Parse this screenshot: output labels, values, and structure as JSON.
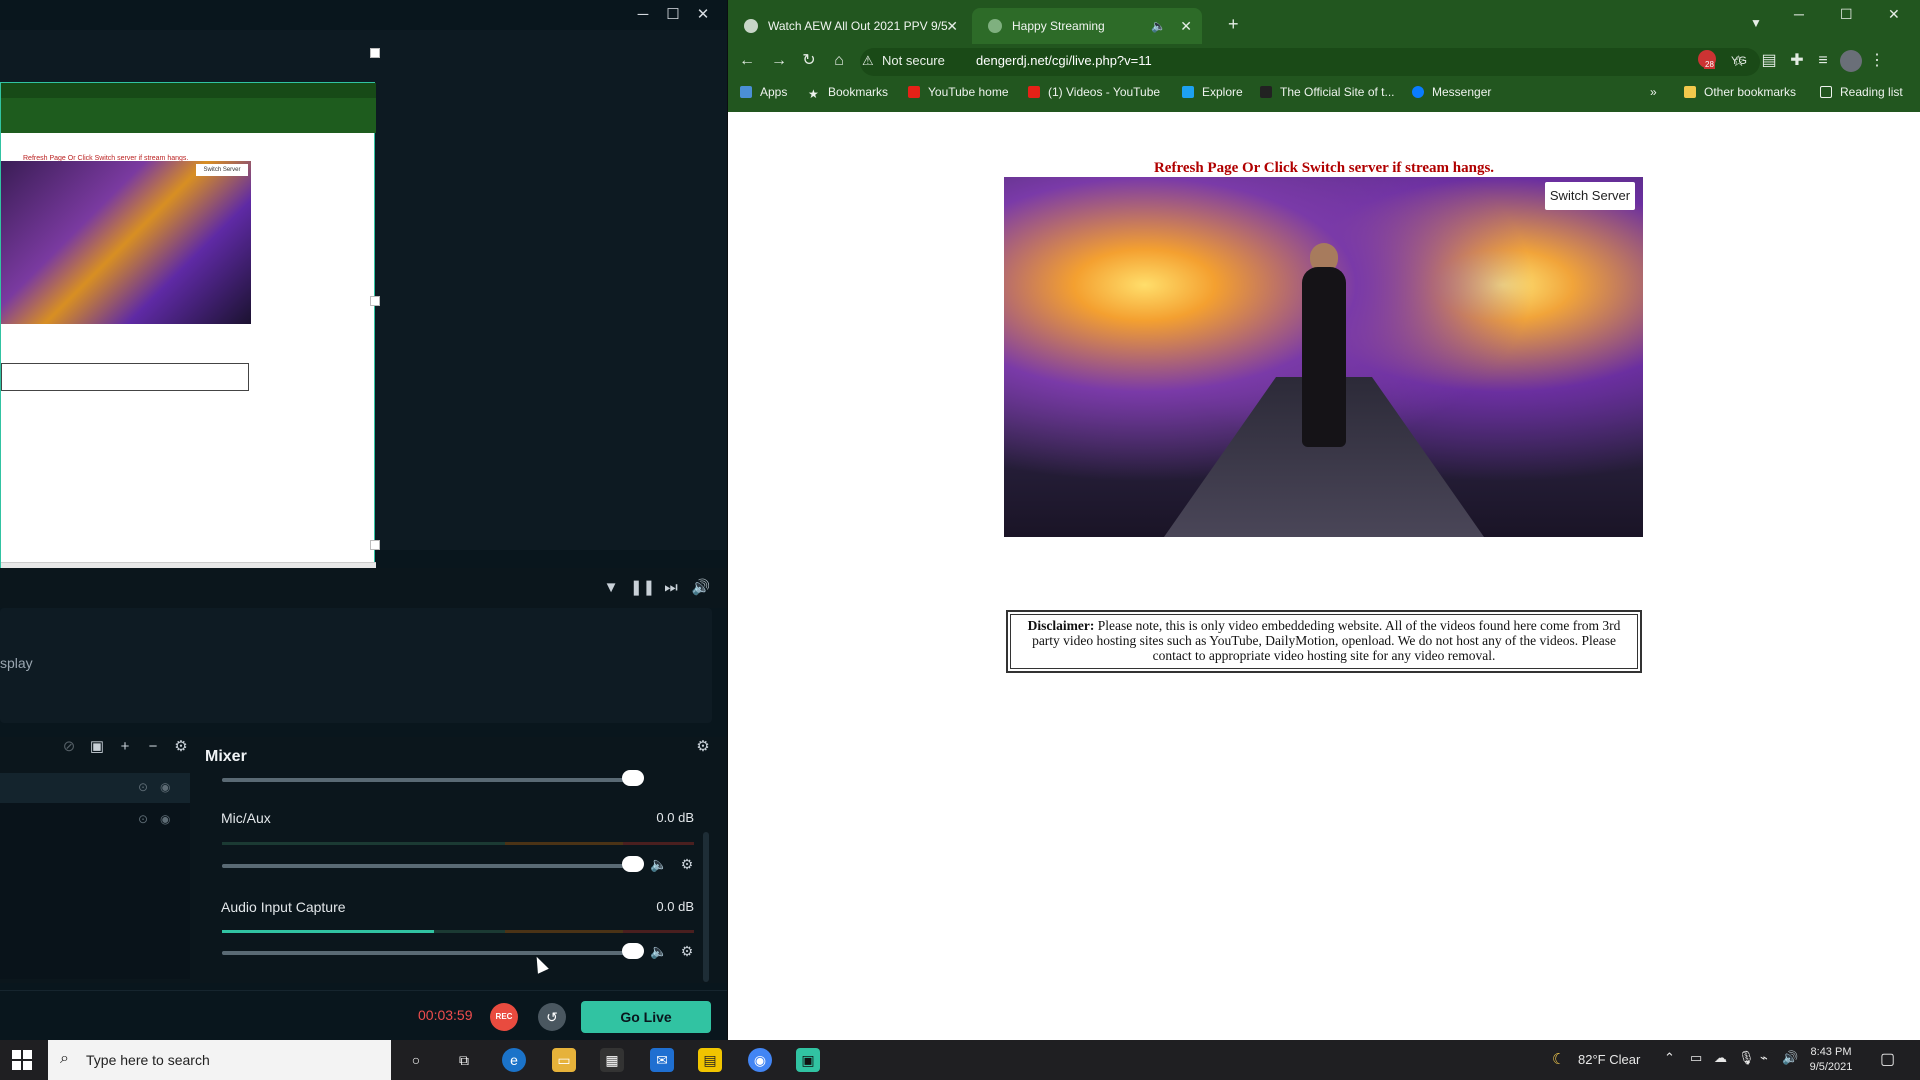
{
  "obs": {
    "display_label": "splay",
    "mixer": {
      "title": "Mixer",
      "channels": [
        {
          "name": "Mic/Aux",
          "db": "0.0 dB",
          "meter_level": 0.0,
          "volume": 1.0
        },
        {
          "name": "Audio Input Capture",
          "db": "0.0 dB",
          "meter_level": 0.45,
          "volume": 1.0
        }
      ]
    },
    "footer": {
      "rec_time": "00:03:59",
      "rec_label": "REC",
      "go_live": "Go Live"
    },
    "mini_preview": {
      "caption": "Refresh Page Or Click Switch server if stream hangs.",
      "switch": "Switch Server"
    }
  },
  "chrome": {
    "tabs": [
      {
        "title": "Watch AEW All Out 2021 PPV 9/5",
        "active": false
      },
      {
        "title": "Happy Streaming",
        "active": true
      }
    ],
    "address": {
      "warning": "Not secure",
      "url": "dengerdj.net/cgi/live.php?v=11"
    },
    "bookmarks": [
      "Apps",
      "Bookmarks",
      "YouTube home",
      "(1) Videos - YouTube",
      "Explore",
      "The Official Site of t...",
      "Messenger"
    ],
    "other_bookmarks": "Other bookmarks",
    "reading_list": "Reading list",
    "extension_badge": "28"
  },
  "page": {
    "refresh_msg": "Refresh Page Or Click Switch server if stream hangs.",
    "switch_server": "Switch Server",
    "disclaimer_label": "Disclaimer:",
    "disclaimer_text": "Please note, this is only video embeddeding website. All of the videos found here come from 3rd party video hosting sites such as YouTube, DailyMotion, openload. We do not host any of the videos. Please contact to appropriate video hosting site for any video removal."
  },
  "taskbar": {
    "search_placeholder": "Type here to search",
    "weather": "82°F  Clear",
    "time": "8:43 PM",
    "date": "9/5/2021"
  },
  "colors": {
    "obs_bg": "#09161d",
    "obs_accent": "#31c3a2",
    "chrome_frame": "#22561f",
    "rec_red": "#e94b3f",
    "page_alert": "#b00000"
  }
}
